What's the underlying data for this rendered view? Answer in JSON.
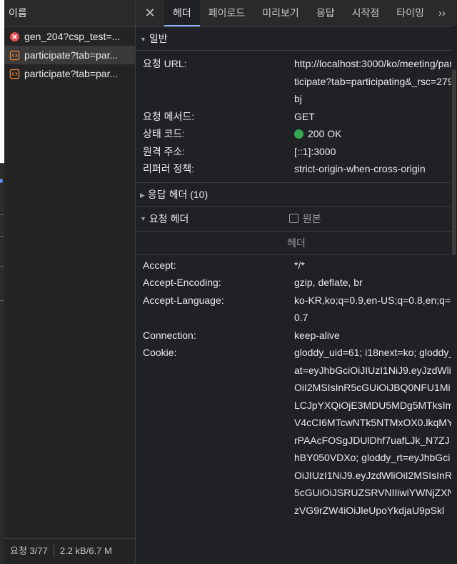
{
  "list": {
    "header": "이름",
    "rows": [
      {
        "name": "gen_204?csp_test=...",
        "status": "error"
      },
      {
        "name": "participate?tab=par...",
        "status": "doc"
      },
      {
        "name": "participate?tab=par...",
        "status": "doc"
      }
    ],
    "footer": {
      "requests": "요청 3/77",
      "transfer": "2.2 kB/6.7 M"
    }
  },
  "tabs": {
    "close_label": "✕",
    "items": [
      "헤더",
      "페이로드",
      "미리보기",
      "응답",
      "시작점",
      "타이밍"
    ],
    "more_label": "››"
  },
  "general": {
    "title": "일반",
    "fields": [
      {
        "key": "요청 URL:",
        "value": "http://localhost:3000/ko/meeting/participate?tab=participating&_rsc=279bj"
      },
      {
        "key": "요청 메서드:",
        "value": "GET"
      },
      {
        "key": "상태 코드:",
        "value": "200 OK"
      },
      {
        "key": "원격 주소:",
        "value": "[::1]:3000"
      },
      {
        "key": "리퍼러 정책:",
        "value": "strict-origin-when-cross-origin"
      }
    ]
  },
  "response_headers": {
    "title": "응답 헤더 (10)"
  },
  "request_headers": {
    "title": "요청 헤더",
    "raw_label": "원본",
    "column_label": "헤더",
    "fields": [
      {
        "key": "Accept:",
        "value": "*/*"
      },
      {
        "key": "Accept-Encoding:",
        "value": "gzip, deflate, br"
      },
      {
        "key": "Accept-Language:",
        "value": "ko-KR,ko;q=0.9,en-US;q=0.8,en;q=0.7"
      },
      {
        "key": "Connection:",
        "value": "keep-alive"
      },
      {
        "key": "Cookie:",
        "value": "gloddy_uid=61; i18next=ko; gloddy_at=eyJhbGciOiJIUzI1NiJ9.eyJzdWliOiI2MSIsInR5cGUiOiJBQ0NFU1MiLCJpYXQiOjE3MDU5MDg5MTksImV4cCI6MTcwNTk5NTMxOX0.lkqMYrPAAcFOSgJDUlDhf7uafLJk_N7ZJhBY050VDXo; gloddy_rt=eyJhbGciOiJIUzI1NiJ9.eyJzdWliOiI2MSIsInR5cGUiOiJSRUZSRVNIIiwiYWNjZXNzVG9rZW4iOiJleUpoYkdjaU9pSkl"
      }
    ]
  },
  "colors": {
    "background": "#202124",
    "status_ok": "#34a853",
    "error": "#e24b4b",
    "doc_icon": "#e8833a",
    "tab_active": "#8ab4f8"
  }
}
